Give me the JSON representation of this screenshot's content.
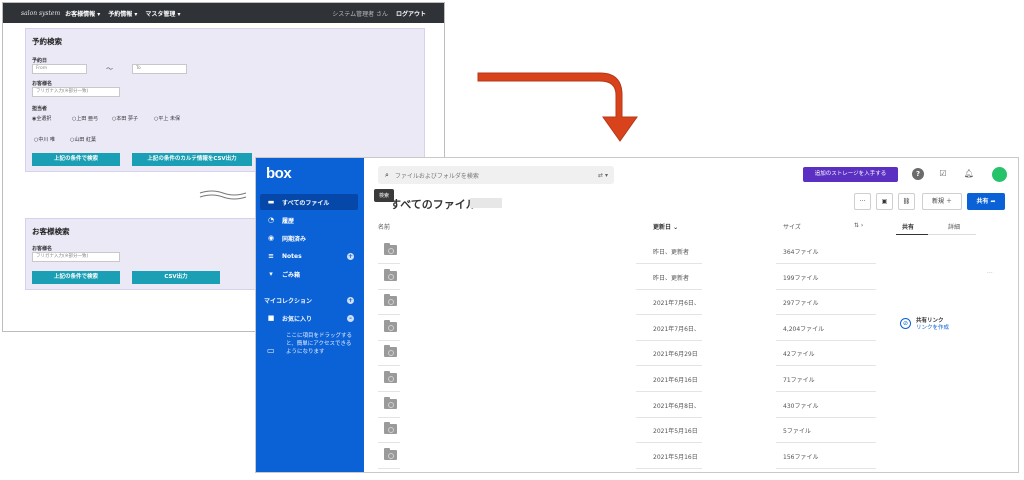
{
  "salon": {
    "brand": "salon system",
    "menus": [
      "お客様情報 ▾",
      "予約情報 ▾",
      "マスタ管理 ▾"
    ],
    "user": "システム管理者 さん",
    "logout": "ログアウト",
    "reservation_search": {
      "title": "予約検索",
      "date_label": "予約日",
      "from_placeholder": "From",
      "tilde": "〜",
      "to_placeholder": "To",
      "customer_label": "お客様名",
      "customer_placeholder": "フリガナ入力(※部分一致)",
      "staff_label": "担当者",
      "staff_options": [
        "全選択",
        "上田 亜弓",
        "本田 夢子",
        "平上 未保",
        "中川 唯",
        "山田 紅葉"
      ],
      "search_button": "上記の条件で検索",
      "csv_button": "上記の条件のカルテ情報をCSV出力"
    },
    "customer_search": {
      "title": "お客様検索",
      "customer_label": "お客様名",
      "customer_placeholder": "フリガナ入力(※部分一致)",
      "search_button": "上記の条件で検索",
      "csv_button": "CSV出力"
    }
  },
  "box": {
    "logo": "box",
    "sidebar": {
      "items": [
        {
          "label": "すべてのファイル",
          "icon": "folder-icon"
        },
        {
          "label": "履歴",
          "icon": "clock-icon"
        },
        {
          "label": "同期済み",
          "icon": "sync-icon"
        },
        {
          "label": "Notes",
          "icon": "notes-icon"
        },
        {
          "label": "ごみ箱",
          "icon": "trash-icon"
        },
        {
          "label": "マイコレクション",
          "icon": ""
        },
        {
          "label": "お気に入り",
          "icon": "star-icon"
        }
      ],
      "favorites_hint": "ここに項目をドラッグすると、簡単にアクセスできるようになります"
    },
    "search_placeholder": "ファイルおよびフォルダを検索",
    "tooltip": "検索",
    "breadcrumb": "すべてのファイル ›",
    "storage_button": "追加のストレージを入手する",
    "toolbar": {
      "more": "···",
      "new": "新規 ＋",
      "share": "共有 ➦"
    },
    "columns": {
      "name": "名前",
      "updated": "更新日 ⌄",
      "size": "サイズ",
      "view": "⇅ ›",
      "share_tab": "共有",
      "detail_tab": "詳細"
    },
    "rows": [
      {
        "updated": "昨日、更新者",
        "size": "364ファイル"
      },
      {
        "updated": "昨日、更新者",
        "size": "199ファイル"
      },
      {
        "updated": "2021年7月6日、",
        "size": "297ファイル"
      },
      {
        "updated": "2021年7月6日、",
        "size": "4,204ファイル"
      },
      {
        "updated": "2021年6月29日",
        "size": "42ファイル"
      },
      {
        "updated": "2021年6月16日",
        "size": "71ファイル"
      },
      {
        "updated": "2021年6月8日、",
        "size": "430ファイル"
      },
      {
        "updated": "2021年5月16日",
        "size": "5ファイル"
      },
      {
        "updated": "2021年5月16日",
        "size": "156ファイル"
      }
    ],
    "right_panel": {
      "link_title": "共有リンク",
      "link_action": "リンクを作成"
    },
    "colors": {
      "sidebar": "#0b61d6",
      "storage": "#5a2fc2",
      "avatar": "#27c36a"
    }
  },
  "arrow_color": "#d9431c"
}
